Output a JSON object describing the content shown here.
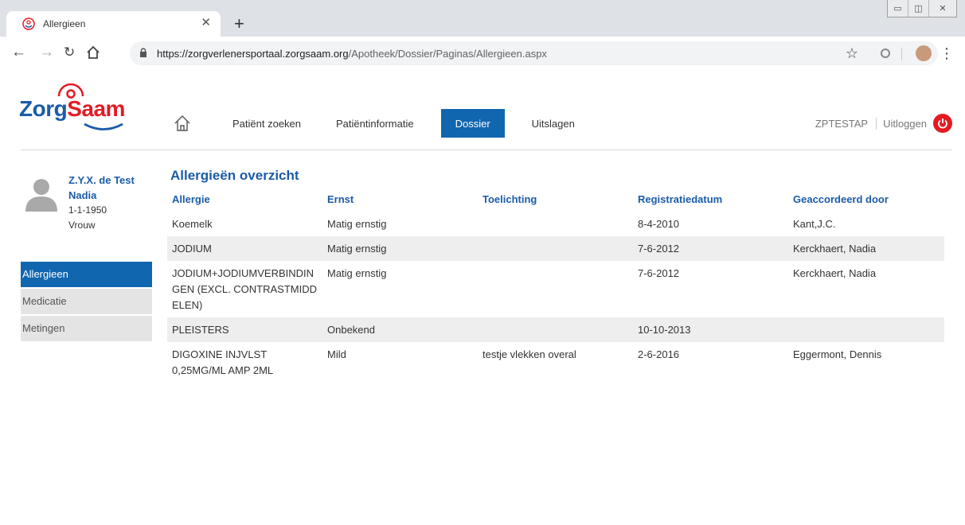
{
  "browser": {
    "tab_title": "Allergieen",
    "url_host": "https://zorgverlenersportaal.zorgsaam.org",
    "url_path": "/Apotheek/Dossier/Paginas/Allergieen.aspx"
  },
  "logo": {
    "part1": "Zorg",
    "part2": "Saam"
  },
  "nav": {
    "items": [
      {
        "label": "Patiënt zoeken",
        "active": false
      },
      {
        "label": "Patiëntinformatie",
        "active": false
      },
      {
        "label": "Dossier",
        "active": true
      },
      {
        "label": "Uitslagen",
        "active": false
      }
    ]
  },
  "user": {
    "name": "ZPTESTAP",
    "logout_label": "Uitloggen"
  },
  "patient": {
    "surname": "Z.Y.X. de Test",
    "firstname": "Nadia",
    "dob": "1-1-1950",
    "gender": "Vrouw"
  },
  "sidenav": {
    "items": [
      {
        "label": "Allergieen",
        "active": true
      },
      {
        "label": "Medicatie",
        "active": false
      },
      {
        "label": "Metingen",
        "active": false
      }
    ]
  },
  "main": {
    "title": "Allergieën overzicht",
    "columns": [
      "Allergie",
      "Ernst",
      "Toelichting",
      "Registratiedatum",
      "Geaccordeerd door"
    ],
    "rows": [
      {
        "allergie": "Koemelk",
        "ernst": "Matig ernstig",
        "toelichting": "",
        "datum": "8-4-2010",
        "door": "Kant,J.C."
      },
      {
        "allergie": "JODIUM",
        "ernst": "Matig ernstig",
        "toelichting": "",
        "datum": "7-6-2012",
        "door": "Kerckhaert, Nadia"
      },
      {
        "allergie": "JODIUM+JODIUMVERBINDINGEN (EXCL. CONTRASTMIDDELEN)",
        "ernst": "Matig ernstig",
        "toelichting": "",
        "datum": "7-6-2012",
        "door": "Kerckhaert, Nadia"
      },
      {
        "allergie": "PLEISTERS",
        "ernst": "Onbekend",
        "toelichting": "",
        "datum": "10-10-2013",
        "door": ""
      },
      {
        "allergie": "DIGOXINE INJVLST 0,25MG/ML AMP 2ML",
        "ernst": "Mild",
        "toelichting": "testje vlekken overal",
        "datum": "2-6-2016",
        "door": "Eggermont, Dennis"
      }
    ]
  },
  "colors": {
    "brand_blue": "#1166b0",
    "brand_red": "#e21b23"
  }
}
